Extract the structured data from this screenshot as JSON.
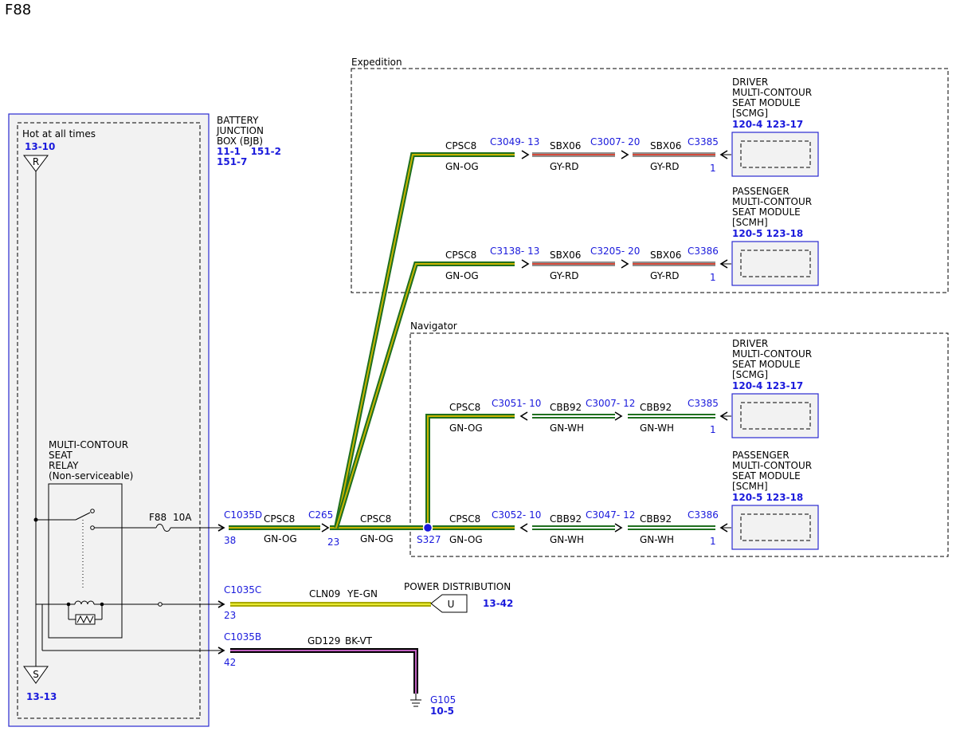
{
  "page_title": "F88",
  "colors": {
    "gn_og_outer": "#1f6f1f",
    "gn_og_inner": "#c8b400",
    "gn_wh_outer": "#1f6f1f",
    "gn_wh_inner": "#ffffff",
    "gy_rd_outer": "#8f8f8f",
    "gy_rd_inner": "#d44a3a",
    "ye_gn_outer": "#a8a800",
    "ye_gn_inner": "#e8ea30",
    "bk_vt_outer": "#000000",
    "bk_vt_inner": "#c060c0",
    "ref_blue": "#1a1adc",
    "module_box": "#2a2ad0"
  },
  "groups": {
    "expedition": "Expedition",
    "navigator": "Navigator"
  },
  "bjb": {
    "title_lines": [
      "BATTERY",
      "JUNCTION",
      "BOX (BJB)"
    ],
    "ref_line1": "11-1   151-2",
    "ref_line2": "151-7",
    "hot_label": "Hot at all times",
    "hot_ref": "13-10",
    "r_letter": "R",
    "s_letter": "S",
    "s_ref": "13-13"
  },
  "relay": {
    "lines": [
      "MULTI-CONTOUR",
      "SEAT",
      "RELAY",
      "(Non-serviceable)"
    ],
    "fuse_label": "F88",
    "fuse_rating": "10A"
  },
  "feed": {
    "conn1": "C1035D",
    "pin1": "38",
    "circuit": "CPSC8",
    "color": "GN-OG",
    "conn2": "C265",
    "pin2": "23",
    "splice": "S327"
  },
  "expedition_rows": [
    {
      "lead_circuit": "CPSC8",
      "lead_color": "GN-OG",
      "conn_a": "C3049",
      "pin_a": "13",
      "mid_circuit": "SBX06",
      "mid_color": "GY-RD",
      "conn_b": "C3007",
      "pin_b": "20",
      "end_circuit": "SBX06",
      "end_color": "GY-RD",
      "module_conn": "C3385",
      "module_pin": "1",
      "module_lines": [
        "DRIVER",
        "MULTI-CONTOUR",
        "SEAT MODULE",
        "[SCMG]"
      ],
      "module_ref": "120-4   123-17"
    },
    {
      "lead_circuit": "CPSC8",
      "lead_color": "GN-OG",
      "conn_a": "C3138",
      "pin_a": "13",
      "mid_circuit": "SBX06",
      "mid_color": "GY-RD",
      "conn_b": "C3205",
      "pin_b": "20",
      "end_circuit": "SBX06",
      "end_color": "GY-RD",
      "module_conn": "C3386",
      "module_pin": "1",
      "module_lines": [
        "PASSENGER",
        "MULTI-CONTOUR",
        "SEAT MODULE",
        "[SCMH]"
      ],
      "module_ref": "120-5   123-18"
    }
  ],
  "navigator_rows": [
    {
      "lead_circuit": "CPSC8",
      "lead_color": "GN-OG",
      "conn_a": "C3051",
      "pin_a": "10",
      "mid_circuit": "CBB92",
      "mid_color": "GN-WH",
      "conn_b": "C3007",
      "pin_b": "12",
      "end_circuit": "CBB92",
      "end_color": "GN-WH",
      "module_conn": "C3385",
      "module_pin": "1",
      "module_lines": [
        "DRIVER",
        "MULTI-CONTOUR",
        "SEAT MODULE",
        "[SCMG]"
      ],
      "module_ref": "120-4   123-17"
    },
    {
      "lead_circuit": "CPSC8",
      "lead_color": "GN-OG",
      "conn_a": "C3052",
      "pin_a": "10",
      "mid_circuit": "CBB92",
      "mid_color": "GN-WH",
      "conn_b": "C3047",
      "pin_b": "12",
      "end_circuit": "CBB92",
      "end_color": "GN-WH",
      "module_conn": "C3386",
      "module_pin": "1",
      "module_lines": [
        "PASSENGER",
        "MULTI-CONTOUR",
        "SEAT MODULE",
        "[SCMH]"
      ],
      "module_ref": "120-5   123-18"
    }
  ],
  "coil_feed": {
    "conn": "C1035C",
    "pin": "23",
    "circuit": "CLN09",
    "color": "YE-GN",
    "dest_label": "POWER DISTRIBUTION",
    "dest_letter": "U",
    "dest_ref": "13-42"
  },
  "ground": {
    "conn": "C1035B",
    "pin": "42",
    "circuit": "GD129",
    "color": "BK-VT",
    "ground_id": "G105",
    "ground_ref": "10-5"
  }
}
